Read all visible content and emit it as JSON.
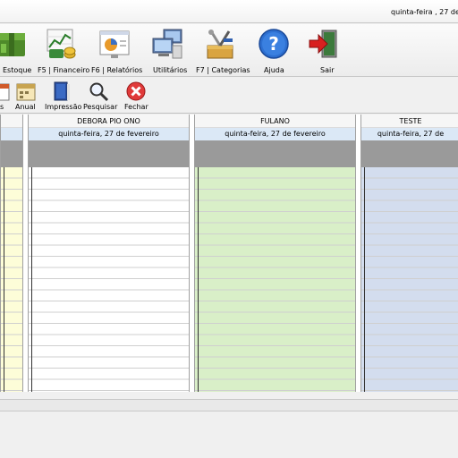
{
  "titlebar": {
    "date_text": "quinta-feira , 27  de"
  },
  "toolbar": {
    "items": [
      {
        "label": "Estoque",
        "icon": "box-stock-icon"
      },
      {
        "label": "F5 | Financeiro",
        "icon": "money-chart-icon"
      },
      {
        "label": "F6 | Relatórios",
        "icon": "report-chart-icon"
      },
      {
        "label": "Utilitários",
        "icon": "computers-icon"
      },
      {
        "label": "F7 | Categorias",
        "icon": "tools-box-icon"
      },
      {
        "label": "Ajuda",
        "icon": "help-icon"
      },
      {
        "label": "Sair",
        "icon": "exit-door-icon"
      }
    ]
  },
  "toolbar2": {
    "items": [
      {
        "label": "s",
        "icon": "calendar-icon"
      },
      {
        "label": "Anual",
        "icon": "calendar-year-icon"
      },
      {
        "label": "Impressão",
        "icon": "print-book-icon"
      },
      {
        "label": "Pesquisar",
        "icon": "magnifier-icon"
      },
      {
        "label": "Fechar",
        "icon": "close-red-icon"
      }
    ]
  },
  "agenda": {
    "columns": [
      {
        "name": "",
        "date": "",
        "color": "#fdfdd8"
      },
      {
        "name": "DEBORA PIO ONO",
        "date": "quinta-feira, 27 de fevereiro",
        "color": "#ffffff"
      },
      {
        "name": "FULANO",
        "date": "quinta-feira, 27 de fevereiro",
        "color": "#d9efc8"
      },
      {
        "name": "TESTE",
        "date": "quinta-feira, 27 de",
        "color": "#d3ddee"
      }
    ]
  },
  "colors": {
    "header_gray": "#9a9a9a",
    "date_band": "#dbe8f6"
  }
}
